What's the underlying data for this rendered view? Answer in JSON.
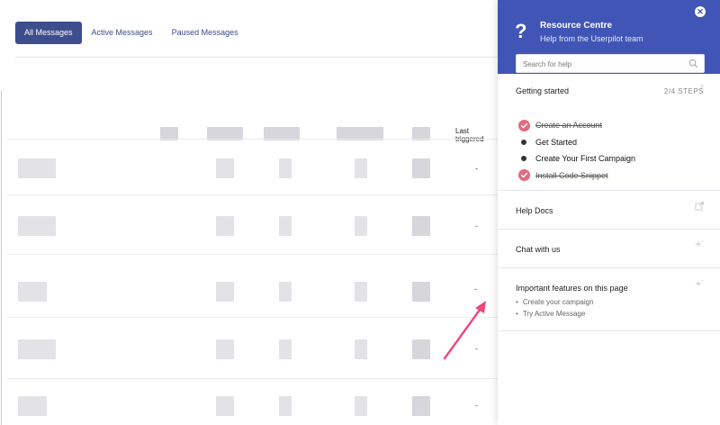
{
  "tabs": [
    {
      "label": "All Messages",
      "active": true
    },
    {
      "label": "Active Messages",
      "active": false
    },
    {
      "label": "Paused Messages",
      "active": false
    }
  ],
  "table": {
    "last_triggered_header": "Last triggered",
    "rows": [
      {
        "last_triggered": "-"
      },
      {
        "last_triggered": "-"
      },
      {
        "last_triggered": "-"
      },
      {
        "last_triggered": "-"
      },
      {
        "last_triggered": "-"
      }
    ]
  },
  "resource_centre": {
    "icon": "question-mark-icon",
    "title": "Resource Centre",
    "subtitle": "Help from the Userpilot team",
    "close_icon": "close-icon",
    "search": {
      "placeholder": "Search for help",
      "value": ""
    },
    "getting_started": {
      "title": "Getting started",
      "steps_label": "2/4 STEPS",
      "items": [
        {
          "label": "Create an Account",
          "done": true
        },
        {
          "label": "Get Started",
          "done": false
        },
        {
          "label": "Create Your First Campaign",
          "done": false
        },
        {
          "label": "Install Code Snippet",
          "done": true
        }
      ]
    },
    "sections": [
      {
        "label": "Help Docs",
        "icon": "external-link-icon"
      },
      {
        "label": "Chat with us",
        "icon": "sparkle-icon"
      },
      {
        "label": "Important features on this page",
        "icon": "sparkle-icon"
      }
    ],
    "features": [
      "Create your campaign",
      "Try Active Message"
    ]
  },
  "colors": {
    "panel_header": "#4055b5",
    "active_tab": "#3e4d8c",
    "check_done": "#e06c7d",
    "arrow": "#f0467a"
  }
}
